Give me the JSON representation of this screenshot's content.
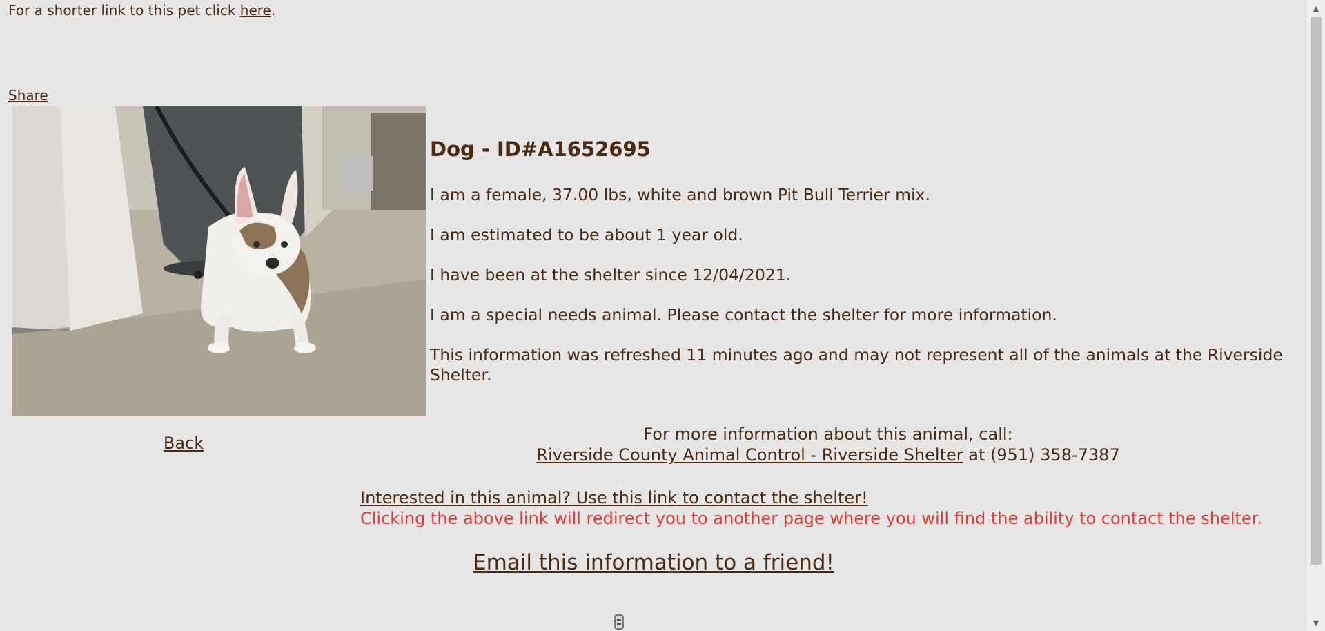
{
  "shortlink": {
    "prefix": "For a shorter link to this pet click ",
    "link": "here",
    "suffix": "."
  },
  "share_label": "Share",
  "back_label": "Back",
  "pet": {
    "heading": "Dog - ID#A1652695",
    "description": "I am a female, 37.00 lbs, white and brown Pit Bull Terrier mix.",
    "age": "I am estimated to be about 1 year old.",
    "since": "I have been at the shelter since 12/04/2021.",
    "special_needs": "I am a special needs animal. Please contact the shelter for more information.",
    "refresh_note": "This information was refreshed 11 minutes ago and may not represent all of the animals at the Riverside Shelter."
  },
  "contact": {
    "intro": "For more information about this animal, call:",
    "shelter_name": "Riverside County Animal Control - Riverside Shelter",
    "phone_text": " at (951) 358-7387"
  },
  "interest": {
    "link": "Interested in this animal? Use this link to contact the shelter!",
    "warning": "Clicking the above link will redirect you to another page where you will find the ability to contact the shelter."
  },
  "email_link": "Email this information to a friend!",
  "colors": {
    "background": "#e6e6e6",
    "text": "#4a2a10",
    "warning": "#e03c32"
  }
}
